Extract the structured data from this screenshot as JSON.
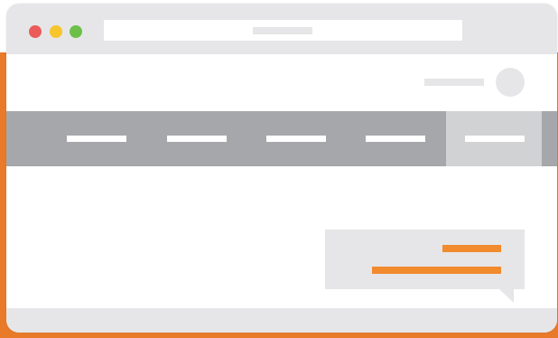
{
  "colors": {
    "accent": "#f28a2e",
    "backing": "#e87a2a",
    "chrome": "#e6e6e8",
    "navbar": "#a6a7aa",
    "nav_active": "#d1d2d4",
    "close_dot": "#ec5b5b",
    "minimize_dot": "#f7c52c",
    "maximize_dot": "#6cc04a"
  },
  "window": {
    "controls": [
      "close-icon",
      "minimize-icon",
      "maximize-icon"
    ]
  },
  "address_bar": {
    "text": ""
  },
  "header": {
    "user_label": "",
    "avatar_icon": "avatar-icon"
  },
  "nav": {
    "items": [
      {
        "label": "",
        "active": false
      },
      {
        "label": "",
        "active": false
      },
      {
        "label": "",
        "active": false
      },
      {
        "label": "",
        "active": false
      },
      {
        "label": "",
        "active": true
      }
    ]
  },
  "tooltip": {
    "line1": "",
    "line2": ""
  },
  "statusbar": {
    "text": ""
  }
}
